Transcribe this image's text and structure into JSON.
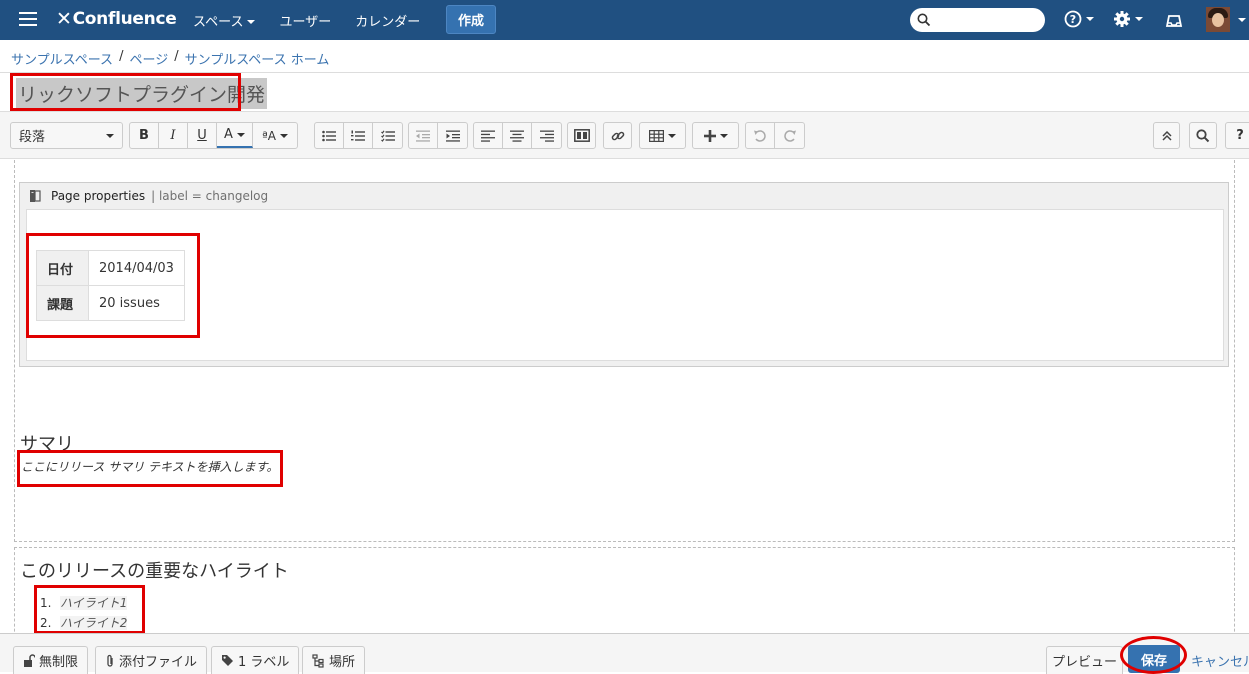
{
  "header": {
    "logo_text": "Confluence",
    "nav": {
      "spaces": "スペース",
      "users": "ユーザー",
      "calendar": "カレンダー"
    },
    "create_label": "作成",
    "search_placeholder": ""
  },
  "breadcrumb": {
    "items": [
      "サンプルスペース",
      "ページ",
      "サンプルスペース ホーム"
    ],
    "separator": "/"
  },
  "page": {
    "title": "リックソフトプラグイン開発"
  },
  "toolbar": {
    "paragraph_style": "段落",
    "bold": "B",
    "italic": "I",
    "underline": "U",
    "text_color": "A",
    "format": "ªA"
  },
  "macro": {
    "name": "Page properties",
    "params": "| label = changelog",
    "rows": [
      {
        "key": "日付",
        "value": "2014/04/03"
      },
      {
        "key": "課題",
        "value": "20 issues"
      }
    ]
  },
  "summary": {
    "heading": "サマリ",
    "placeholder": "ここにリリース サマリ テキストを挿入します。"
  },
  "highlights": {
    "heading": "このリリースの重要なハイライト",
    "items": [
      {
        "num": "1.",
        "text": "ハイライト1"
      },
      {
        "num": "2.",
        "text": "ハイライト2"
      }
    ]
  },
  "bottom": {
    "restrictions": "無制限",
    "attachments": "添付ファイル",
    "labels": "1 ラベル",
    "location": "場所",
    "preview": "プレビュー",
    "save": "保存",
    "cancel": "キャンセル"
  },
  "colors": {
    "header_bg": "#205081",
    "accent": "#3572b0",
    "link": "#3b73af",
    "annotation_red": "#e00000"
  }
}
